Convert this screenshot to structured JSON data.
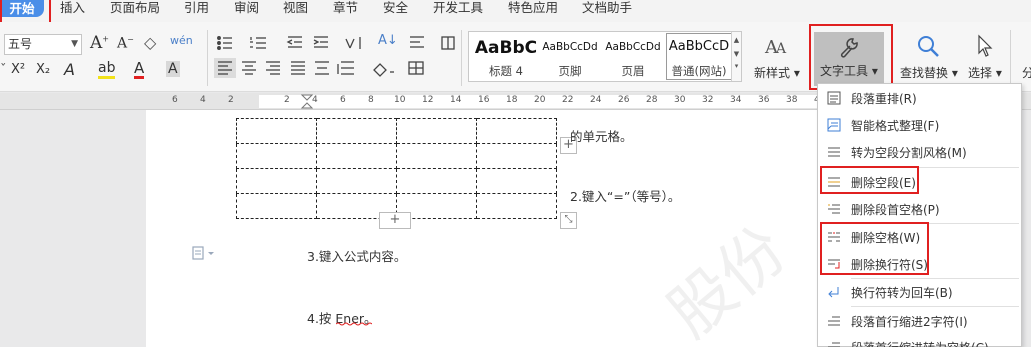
{
  "menu_tabs": [
    "开始",
    "插入",
    "页面布局",
    "引用",
    "审阅",
    "视图",
    "章节",
    "安全",
    "开发工具",
    "特色应用",
    "文档助手"
  ],
  "ribbon": {
    "font_size_value": "五号",
    "styles": [
      {
        "preview": "AaBbC",
        "caption": "标题 4"
      },
      {
        "preview": "AaBbCcDd",
        "caption": "页脚"
      },
      {
        "preview": "AaBbCcDd",
        "caption": "页眉"
      },
      {
        "preview": "AaBbCcD",
        "caption": "普通(网站)"
      }
    ],
    "new_style_label": "新样式",
    "text_tools_label": "文字工具",
    "find_replace_label": "查找替换",
    "select_label": "选择",
    "partial_label": "分",
    "glyphs": {
      "increase_font": "A",
      "decrease_font": "A",
      "clear_format": "◇",
      "pinyin": "wén",
      "superscript": "X²",
      "subscript": "X₂",
      "text_effect": "A",
      "highlight": "ab",
      "font_color": "A",
      "char_shading": "A",
      "sort": "A↓"
    }
  },
  "ruler_numbers": [
    "6",
    "4",
    "2",
    "2",
    "4",
    "6",
    "8",
    "10",
    "12",
    "14",
    "16",
    "18",
    "20",
    "22",
    "24",
    "26",
    "28",
    "30",
    "32",
    "34",
    "36",
    "38",
    "40"
  ],
  "document": {
    "line_partial": "的单元格。",
    "step2": "2.键入“=”（等号）。",
    "step3": "3.键入公式内容。",
    "step4": "4.按 Ener。",
    "watermark": "股份"
  },
  "text_tools_menu": [
    {
      "label": "段落重排(R)",
      "icon": "paragraph-rearrange-icon"
    },
    {
      "label": "智能格式整理(F)",
      "icon": "smart-format-icon"
    },
    {
      "label": "转为空段分割风格(M)",
      "icon": "empty-paragraph-split-icon"
    },
    {
      "label": "删除空段(E)",
      "icon": "delete-empty-paragraph-icon"
    },
    {
      "label": "删除段首空格(P)",
      "icon": "delete-leading-space-icon"
    },
    {
      "label": "删除空格(W)",
      "icon": "delete-space-icon"
    },
    {
      "label": "删除换行符(S)",
      "icon": "delete-line-break-icon"
    },
    {
      "label": "换行符转为回车(B)",
      "icon": "line-break-to-enter-icon"
    },
    {
      "label": "段落首行缩进2字符(I)",
      "icon": "first-line-indent-icon"
    },
    {
      "label": "段落首行缩进转为空格(C)",
      "icon": "indent-to-space-icon"
    }
  ],
  "colors": {
    "accent_blue": "#4a8ee8",
    "highlight_red": "#e02020",
    "text_tools_bg": "#bfbfbf"
  }
}
